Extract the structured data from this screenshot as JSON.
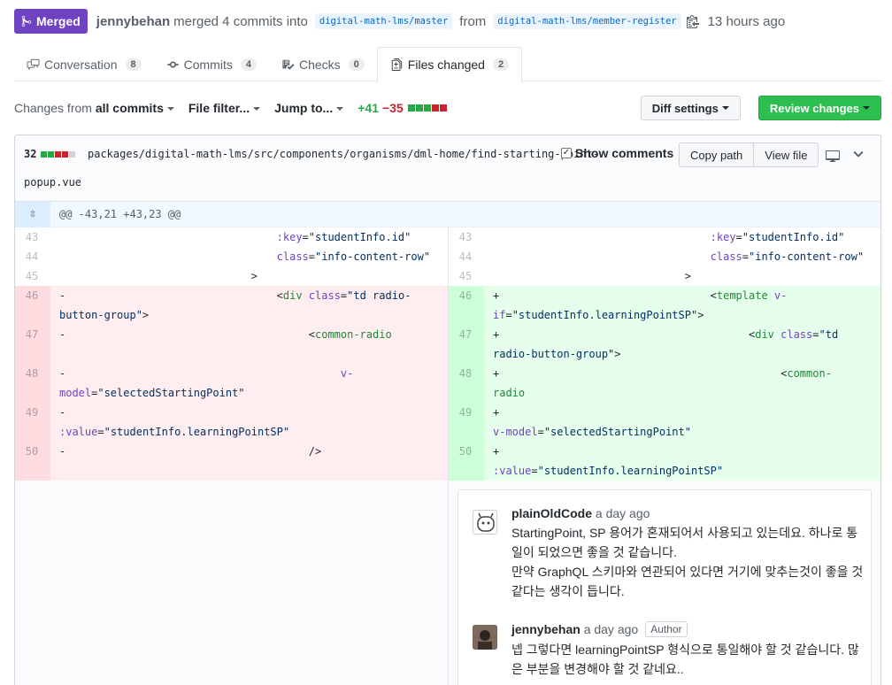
{
  "header": {
    "badge": "Merged",
    "author": "jennybehan",
    "action": "merged 4 commits into",
    "base_ref": "digital-math-lms/master",
    "from": "from",
    "head_ref": "digital-math-lms/member-register",
    "time": "13 hours ago"
  },
  "tabs": [
    {
      "label": "Conversation",
      "count": "8"
    },
    {
      "label": "Commits",
      "count": "4"
    },
    {
      "label": "Checks",
      "count": "0"
    },
    {
      "label": "Files changed",
      "count": "2"
    }
  ],
  "toolbar": {
    "changes_prefix": "Changes from",
    "changes_value": "all commits",
    "file_filter": "File filter...",
    "jump_to": "Jump to...",
    "additions": "+41",
    "deletions": "−35",
    "diff_settings": "Diff settings",
    "review_changes": "Review changes"
  },
  "file": {
    "changes": "32",
    "path_line1": "packages/digital-math-lms/src/components/organisms/dml-home/find-starting-point-",
    "path_line2": "popup.vue",
    "show_comments": "Show comments",
    "copy_path": "Copy path",
    "view_file": "View file",
    "hunk": "@@ -43,21 +43,23 @@"
  },
  "comments": [
    {
      "author": "plainOldCode",
      "time": "a day ago",
      "lines": [
        "StartingPoint, SP 용어가 혼재되어서 사용되고 있는데요. 하나로 통",
        "일이 되었으면 좋을 것 같습니다.",
        "만약 GraphQL 스키마와 연관되어 있다면 거기에 맞추는것이 좋을 것",
        "같다는 생각이 듭니다."
      ]
    },
    {
      "author": "jennybehan",
      "time": "a day ago",
      "label": "Author",
      "lines": [
        "넵 그렇다면 learningPointSP 형식으로 통일해야 할 것 같습니다. 많",
        "은 부분을 변경해야 할 것 같네요.."
      ]
    }
  ],
  "colors": {
    "merged": "#6f42c1",
    "green": "#2cbe4e",
    "link": "#0366d6"
  }
}
